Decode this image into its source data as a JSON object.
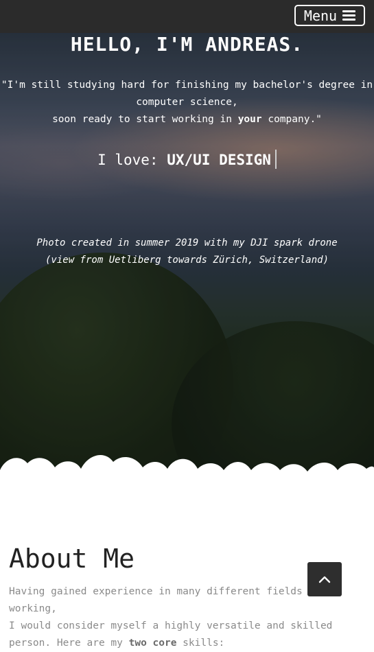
{
  "header": {
    "menu_label": "Menu"
  },
  "hero": {
    "title": "HELLO, I'M ANDREAS.",
    "quote_line1": "\"I'm still studying hard for finishing my bachelor's degree in",
    "quote_line2": "computer science,",
    "quote_line3_before": "soon ready to start working in ",
    "quote_line3_bold": "your",
    "quote_line3_after": " company.\"",
    "love_prefix": "I love: ",
    "love_skill": "UX/UI DESIGN",
    "caption_line1": "Photo created in summer 2019 with my DJI spark drone",
    "caption_line2": "(view from Uetliberg towards Zürich, Switzerland)"
  },
  "about": {
    "heading": "About Me",
    "line1": "Having gained experience in many different fields of working,",
    "line2": "I would consider myself a highly versatile and skilled",
    "line3_before": "person. Here are my ",
    "line3_bold": "two core",
    "line3_after": " skills:"
  },
  "icons": {
    "menu": "hamburger-icon",
    "scroll_top": "chevron-up-icon"
  },
  "colors": {
    "topbar": "#2b2b2b",
    "scroll_button": "#2e2e2e",
    "heading": "#222222",
    "body_text": "#8a8a8a"
  }
}
